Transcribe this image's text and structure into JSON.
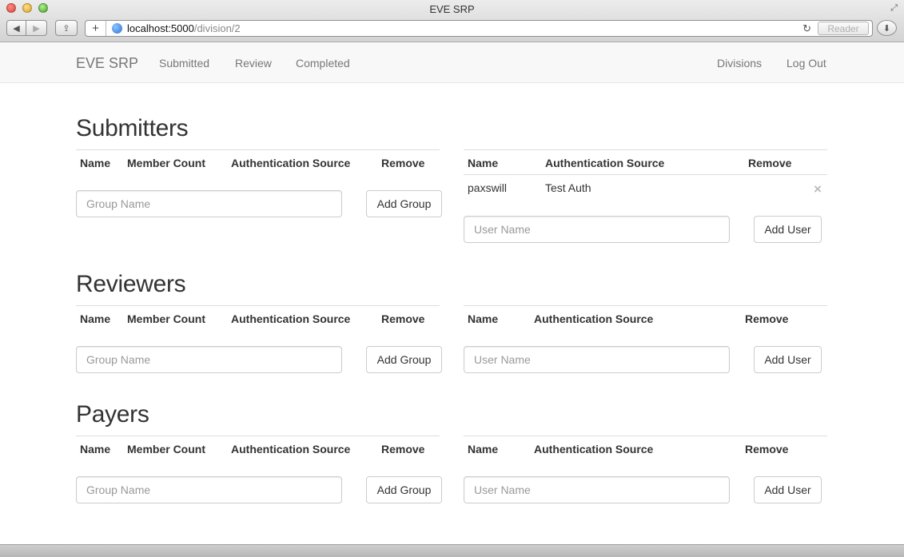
{
  "window": {
    "title": "EVE SRP"
  },
  "browser": {
    "url_host": "localhost:5000",
    "url_path": "/division/2",
    "reader_label": "Reader",
    "back_glyph": "◀",
    "forward_glyph": "▶",
    "share_glyph": "⇪",
    "plus_glyph": "+",
    "reload_glyph": "↻",
    "download_glyph": "⬇",
    "fullscreen_glyph": "⤢"
  },
  "navbar": {
    "brand": "EVE SRP",
    "links": [
      "Submitted",
      "Review",
      "Completed"
    ],
    "right_links": [
      "Divisions",
      "Log Out"
    ]
  },
  "group_table": {
    "headers": [
      "Name",
      "Member Count",
      "Authentication Source",
      "Remove"
    ],
    "input_placeholder": "Group Name",
    "add_label": "Add Group"
  },
  "user_table": {
    "headers": [
      "Name",
      "Authentication Source",
      "Remove"
    ],
    "input_placeholder": "User Name",
    "add_label": "Add User"
  },
  "sections": [
    {
      "title": "Submitters",
      "users": [
        {
          "name": "paxswill",
          "auth_source": "Test Auth",
          "remove_glyph": "×"
        }
      ]
    },
    {
      "title": "Reviewers",
      "users": []
    },
    {
      "title": "Payers",
      "users": []
    }
  ]
}
